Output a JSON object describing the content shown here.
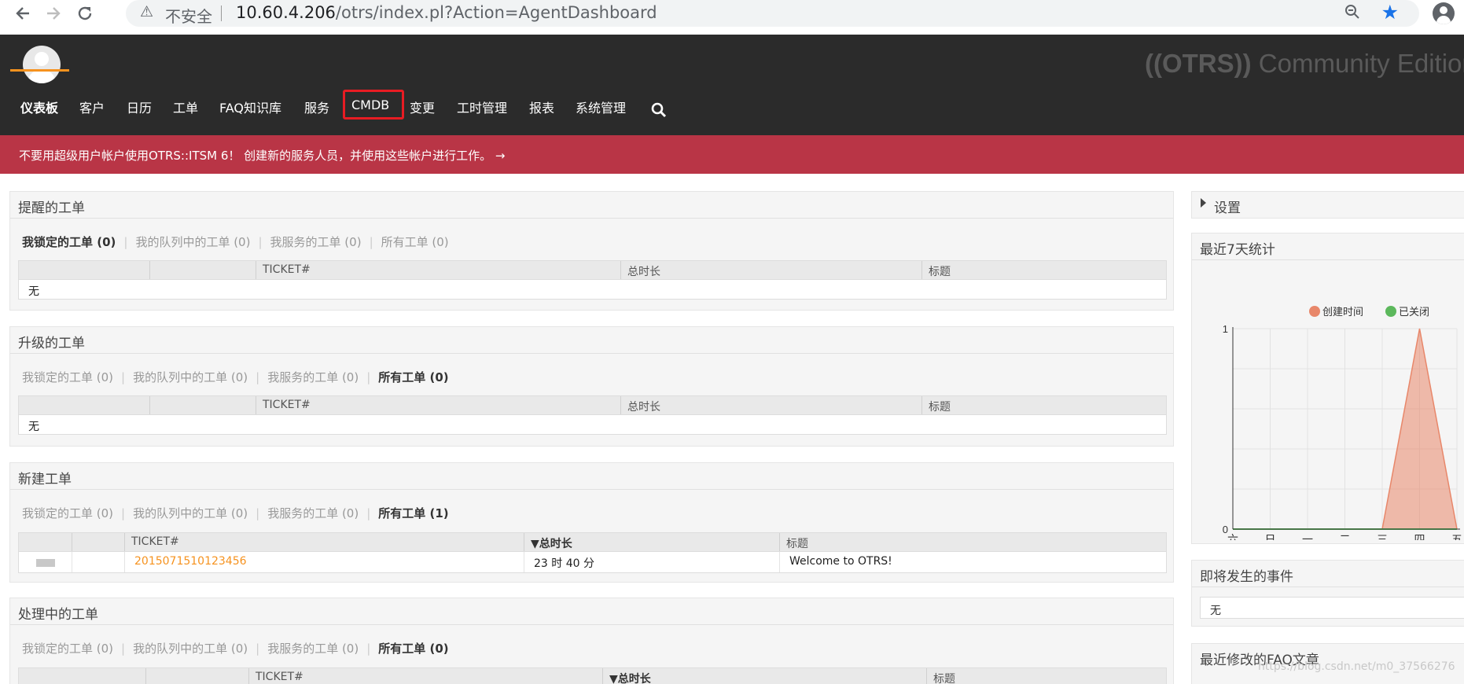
{
  "browser": {
    "back_icon": "arrow-left-icon",
    "forward_icon": "arrow-right-icon",
    "reload_icon": "reload-icon",
    "insecure_label": "不安全",
    "url_host": "10.60.4.206",
    "url_path": "/otrs/index.pl?Action=AgentDashboard"
  },
  "header": {
    "logo_brand": "((OTRS))",
    "logo_edition": " Community Edition",
    "nav": [
      "仪表板",
      "客户",
      "日历",
      "工单",
      "FAQ知识库",
      "服务",
      "CMDB",
      "变更",
      "工时管理",
      "报表",
      "系统管理"
    ],
    "active_nav": "仪表板",
    "highlighted_nav": "CMDB",
    "accent_color": "#f6921e",
    "highlight_color": "#e81c23"
  },
  "alert": {
    "text": "不要用超级用户帐户使用OTRS::ITSM 6！ 创建新的服务人员，并使用这些帐户进行工作。 →",
    "color": "#b93546"
  },
  "widgets": {
    "reminder": {
      "title": "提醒的工单",
      "tabs": [
        "我锁定的工单 (0)",
        "我的队列中的工单 (0)",
        "我服务的工单 (0)",
        "所有工单 (0)"
      ],
      "active_tab": 0,
      "columns": [
        "",
        "",
        "TICKET#",
        "总时长",
        "标题"
      ],
      "empty_text": "无"
    },
    "escalated": {
      "title": "升级的工单",
      "tabs": [
        "我锁定的工单 (0)",
        "我的队列中的工单 (0)",
        "我服务的工单 (0)",
        "所有工单 (0)"
      ],
      "active_tab": 3,
      "columns": [
        "",
        "",
        "TICKET#",
        "总时长",
        "标题"
      ],
      "empty_text": "无"
    },
    "new": {
      "title": "新建工单",
      "tabs": [
        "我锁定的工单 (0)",
        "我的队列中的工单 (0)",
        "我服务的工单 (0)",
        "所有工单 (1)"
      ],
      "active_tab": 3,
      "columns": [
        "",
        "",
        "TICKET#",
        "▼总时长",
        "标题"
      ],
      "row": {
        "ticket": "2015071510123456",
        "age": "23 时 40 分",
        "title": "Welcome to OTRS!"
      }
    },
    "open": {
      "title": "处理中的工单",
      "tabs": [
        "我锁定的工单 (0)",
        "我的队列中的工单 (0)",
        "我服务的工单 (0)",
        "所有工单 (0)"
      ],
      "active_tab": 3,
      "columns": [
        "",
        "",
        "TICKET#",
        "▼总时长",
        "标题"
      ]
    }
  },
  "sidebar": {
    "settings_label": "设置",
    "stats_title": "最近7天统计",
    "upcoming_title": "即将发生的事件",
    "upcoming_empty": "无",
    "faq_title": "最近修改的FAQ文章"
  },
  "chart_data": {
    "type": "area",
    "title": "",
    "categories": [
      "六",
      "日",
      "一",
      "二",
      "三",
      "四",
      "五"
    ],
    "ylim": [
      0,
      1
    ],
    "yticks": [
      "0",
      "1"
    ],
    "grid": true,
    "legend_position": "top-right",
    "series": [
      {
        "name": "创建时间",
        "values": [
          0,
          0,
          0,
          0,
          0,
          1,
          0
        ],
        "color": "#e8876a"
      },
      {
        "name": "已关闭",
        "values": [
          0,
          0,
          0,
          0,
          0,
          0,
          0
        ],
        "color": "#5cb85c"
      }
    ]
  },
  "watermark": "https://blog.csdn.net/m0_37566276"
}
